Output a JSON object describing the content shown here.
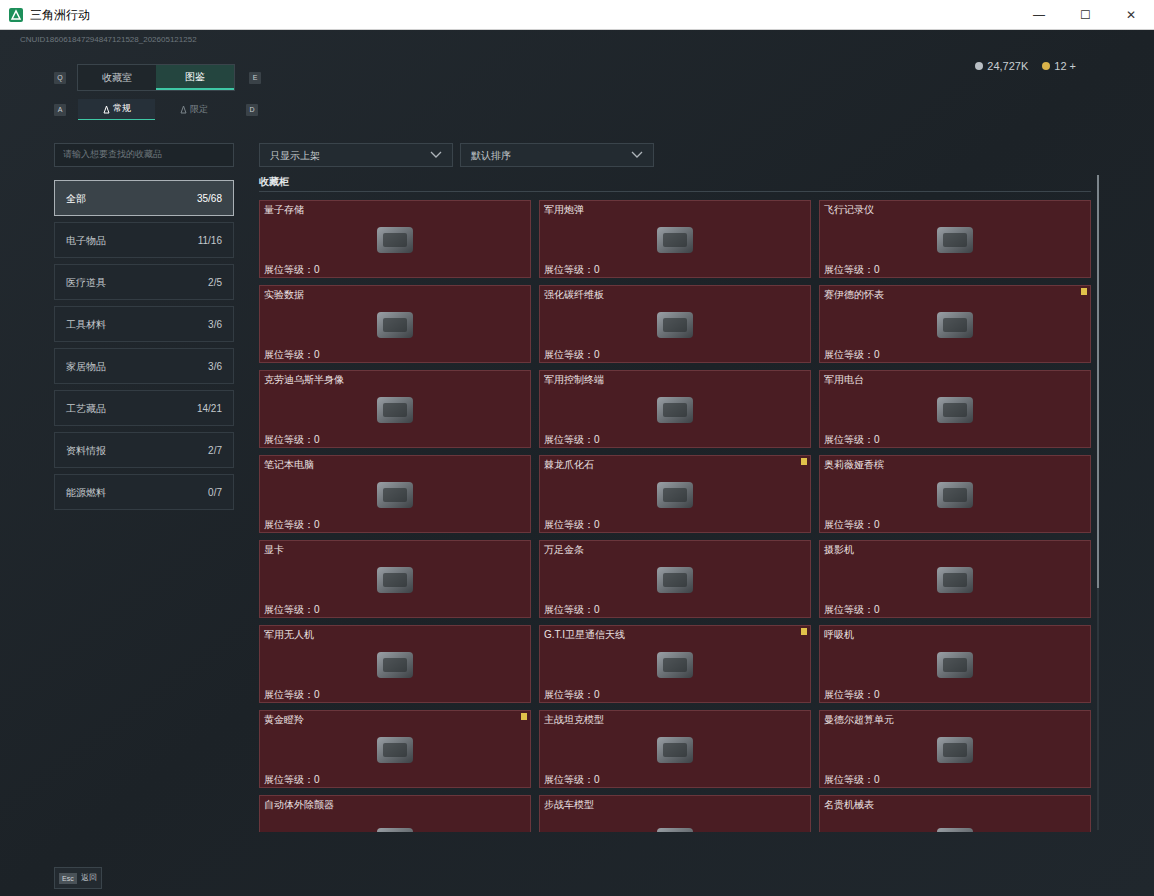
{
  "window": {
    "title": "三角洲行动",
    "controls": [
      "—",
      "☐",
      "✕"
    ]
  },
  "uid": "CNUID186061847294847121528_202605121252",
  "main_tabs": {
    "prev_key": "Q",
    "next_key": "E",
    "items": [
      {
        "label": "收藏室",
        "selected": false
      },
      {
        "label": "图鉴",
        "selected": true
      }
    ]
  },
  "sub_tabs": {
    "prev_key": "A",
    "next_key": "D",
    "items": [
      {
        "label": "常规",
        "selected": true
      },
      {
        "label": "限定",
        "selected": false
      }
    ]
  },
  "currency": [
    {
      "amount": "24,727K",
      "color": "#b8bec4"
    },
    {
      "amount": "12 +",
      "color": "#d9b24a"
    }
  ],
  "search": {
    "placeholder": "请输入想要查找的收藏品"
  },
  "sidebar": {
    "items": [
      {
        "label": "全部",
        "count": "35/68",
        "selected": true
      },
      {
        "label": "电子物品",
        "count": "11/16",
        "selected": false
      },
      {
        "label": "医疗道具",
        "count": "2/5",
        "selected": false
      },
      {
        "label": "工具材料",
        "count": "3/6",
        "selected": false
      },
      {
        "label": "家居物品",
        "count": "3/6",
        "selected": false
      },
      {
        "label": "工艺藏品",
        "count": "14/21",
        "selected": false
      },
      {
        "label": "资料情报",
        "count": "2/7",
        "selected": false
      },
      {
        "label": "能源燃料",
        "count": "0/7",
        "selected": false
      }
    ]
  },
  "filters": [
    "只显示上架",
    "默认排序"
  ],
  "section_title": "收藏柜",
  "items": [
    {
      "name": "量子存储",
      "level": "展位等级：0",
      "badge": false
    },
    {
      "name": "军用炮弹",
      "level": "展位等级：0",
      "badge": false
    },
    {
      "name": "飞行记录仪",
      "level": "展位等级：0",
      "badge": false
    },
    {
      "name": "实验数据",
      "level": "展位等级：0",
      "badge": false
    },
    {
      "name": "强化碳纤维板",
      "level": "展位等级：0",
      "badge": false
    },
    {
      "name": "赛伊德的怀表",
      "level": "展位等级：0",
      "badge": true
    },
    {
      "name": "克劳迪乌斯半身像",
      "level": "展位等级：0",
      "badge": false
    },
    {
      "name": "军用控制终端",
      "level": "展位等级：0",
      "badge": false
    },
    {
      "name": "军用电台",
      "level": "展位等级：0",
      "badge": false
    },
    {
      "name": "笔记本电脑",
      "level": "展位等级：0",
      "badge": false
    },
    {
      "name": "棘龙爪化石",
      "level": "展位等级：0",
      "badge": true
    },
    {
      "name": "奥莉薇娅香槟",
      "level": "展位等级：0",
      "badge": false
    },
    {
      "name": "显卡",
      "level": "展位等级：0",
      "badge": false
    },
    {
      "name": "万足金条",
      "level": "展位等级：0",
      "badge": false
    },
    {
      "name": "摄影机",
      "level": "展位等级：0",
      "badge": false
    },
    {
      "name": "军用无人机",
      "level": "展位等级：0",
      "badge": false
    },
    {
      "name": "G.T.I卫星通信天线",
      "level": "展位等级：0",
      "badge": true
    },
    {
      "name": "呼吸机",
      "level": "展位等级：0",
      "badge": false
    },
    {
      "name": "黄金瞪羚",
      "level": "展位等级：0",
      "badge": true
    },
    {
      "name": "主战坦克模型",
      "level": "展位等级：0",
      "badge": false
    },
    {
      "name": "曼德尔超算单元",
      "level": "展位等级：0",
      "badge": false
    },
    {
      "name": "自动体外除颤器",
      "badge": false
    },
    {
      "name": "步战车模型",
      "badge": false
    },
    {
      "name": "名贵机械表",
      "badge": false
    }
  ],
  "scrollbar": {
    "level": 0.63
  },
  "footer": {
    "key": "Esc",
    "label": "返回"
  }
}
